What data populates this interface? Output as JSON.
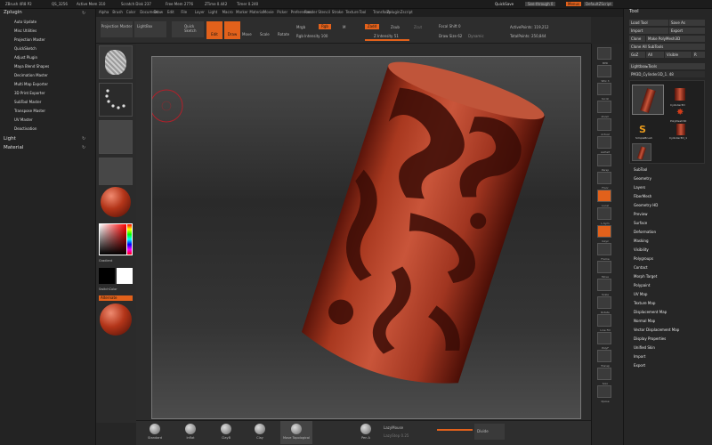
{
  "title_bar": {
    "app": "ZBrush 4R8 P2",
    "items": [
      "QS_3256",
      "Active Mem 310",
      "Scratch Disk 237",
      "Free Mem 2776",
      "ZTime 0.442",
      "Timer 0.240"
    ],
    "quicksave": "QuickSave",
    "see_through": "See-through  0",
    "menus_btn": "Menus",
    "script": "DefaultZScript"
  },
  "menu_bar": [
    "Alpha",
    "Brush",
    "Color",
    "Document",
    "Draw",
    "Edit",
    "File",
    "Layer",
    "Light",
    "Macro",
    "Marker",
    "Material",
    "Movie",
    "Picker",
    "Preferences",
    "Render",
    "Stencil",
    "Stroke",
    "Texture",
    "Tool",
    "Transform",
    "Zplugin",
    "Zscript"
  ],
  "zplugin": {
    "header": "Zplugin",
    "items": [
      "Auto Update",
      "Misc Utilities",
      "Projection Master",
      "QuickSketch",
      "Adjust Plugin",
      "Maya Blend Shapes",
      "Decimation Master",
      "Multi Map Exporter",
      "3D Print Exporter",
      "SubTool Master",
      "Transpose Master",
      "UV Master",
      "Deactivation"
    ],
    "light": "Light",
    "material": "Material"
  },
  "shelf": {
    "alpha": "Alpha Off",
    "stroke": "Dots",
    "texture": "Texture Off",
    "matcap": "MatCap Red Wax",
    "gradient": "Gradient",
    "switch_color": "SwitchColor",
    "alternate": "Alternate"
  },
  "top_toolbar": {
    "projection_master": "Projection Master",
    "lightbox": "LightBox",
    "quick_sketch": "Quick Sketch",
    "edit": "Edit",
    "draw": "Draw",
    "move": "Move",
    "scale": "Scale",
    "rotate": "Rotate",
    "mrgb": "Mrgb",
    "rgb": "Rgb",
    "m": "M",
    "zadd": "Zadd",
    "zsub": "Zsub",
    "zcut": "Zcut",
    "rgb_intensity": "Rgb Intensity 100",
    "z_intensity": "Z Intensity 51",
    "focal_shift": "Focal Shift 0",
    "draw_size": "Draw Size 62",
    "dynamic": "Dynamic",
    "active_points": "ActivePoints: 119,212",
    "total_points": "TotalPoints: 250,844"
  },
  "bottom_brushes": [
    "Standard",
    "Inflat",
    "ClayB",
    "Clay",
    "Move Topological"
  ],
  "bottom_misc": {
    "pen": "Pen A",
    "lazy_mouse": "LazyMouse",
    "lazy_step": "LazyStep 0.25",
    "divide": "Divide"
  },
  "right_shelf": [
    "BPR",
    "SPix 3",
    "Scroll",
    "Zoom",
    "Actual",
    "AAHalf",
    "Persp",
    "Floor",
    "Local",
    "L.Sym",
    "Gxyz",
    "Frame",
    "Move",
    "Scale",
    "Rotate",
    "Line Fill",
    "PolyF",
    "Transp",
    "Solo",
    "Xpose"
  ],
  "tool_panel": {
    "header": "Tool",
    "load_tool": "Load Tool",
    "save_as": "Save As",
    "import": "Import",
    "export": "Export",
    "clone": "Clone",
    "make_polymesh": "Make PolyMesh3D",
    "clone_all": "Clone All SubTools",
    "goz": "GoZ",
    "all": "All",
    "visible": "Visible",
    "r": "R",
    "lightbox_tools": "Lightbox▸Tools",
    "current_tool": "PM3D_Cylinder3D_1. 48",
    "tools": [
      "PM3D_Cylinder3D",
      "Cylinder3D",
      "PolyMesh3D",
      "SimpleBrush",
      "Cylinder3D_1"
    ],
    "sections": [
      "SubTool",
      "Geometry",
      "Layers",
      "FiberMesh",
      "Geometry HD",
      "Preview",
      "Surface",
      "Deformation",
      "Masking",
      "Visibility",
      "Polygroups",
      "Contact",
      "Morph Target",
      "Polypaint",
      "UV Map",
      "Texture Map",
      "Displacement Map",
      "Normal Map",
      "Vector Displacement Map",
      "Display Properties",
      "Unified Skin",
      "Import",
      "Export"
    ]
  }
}
